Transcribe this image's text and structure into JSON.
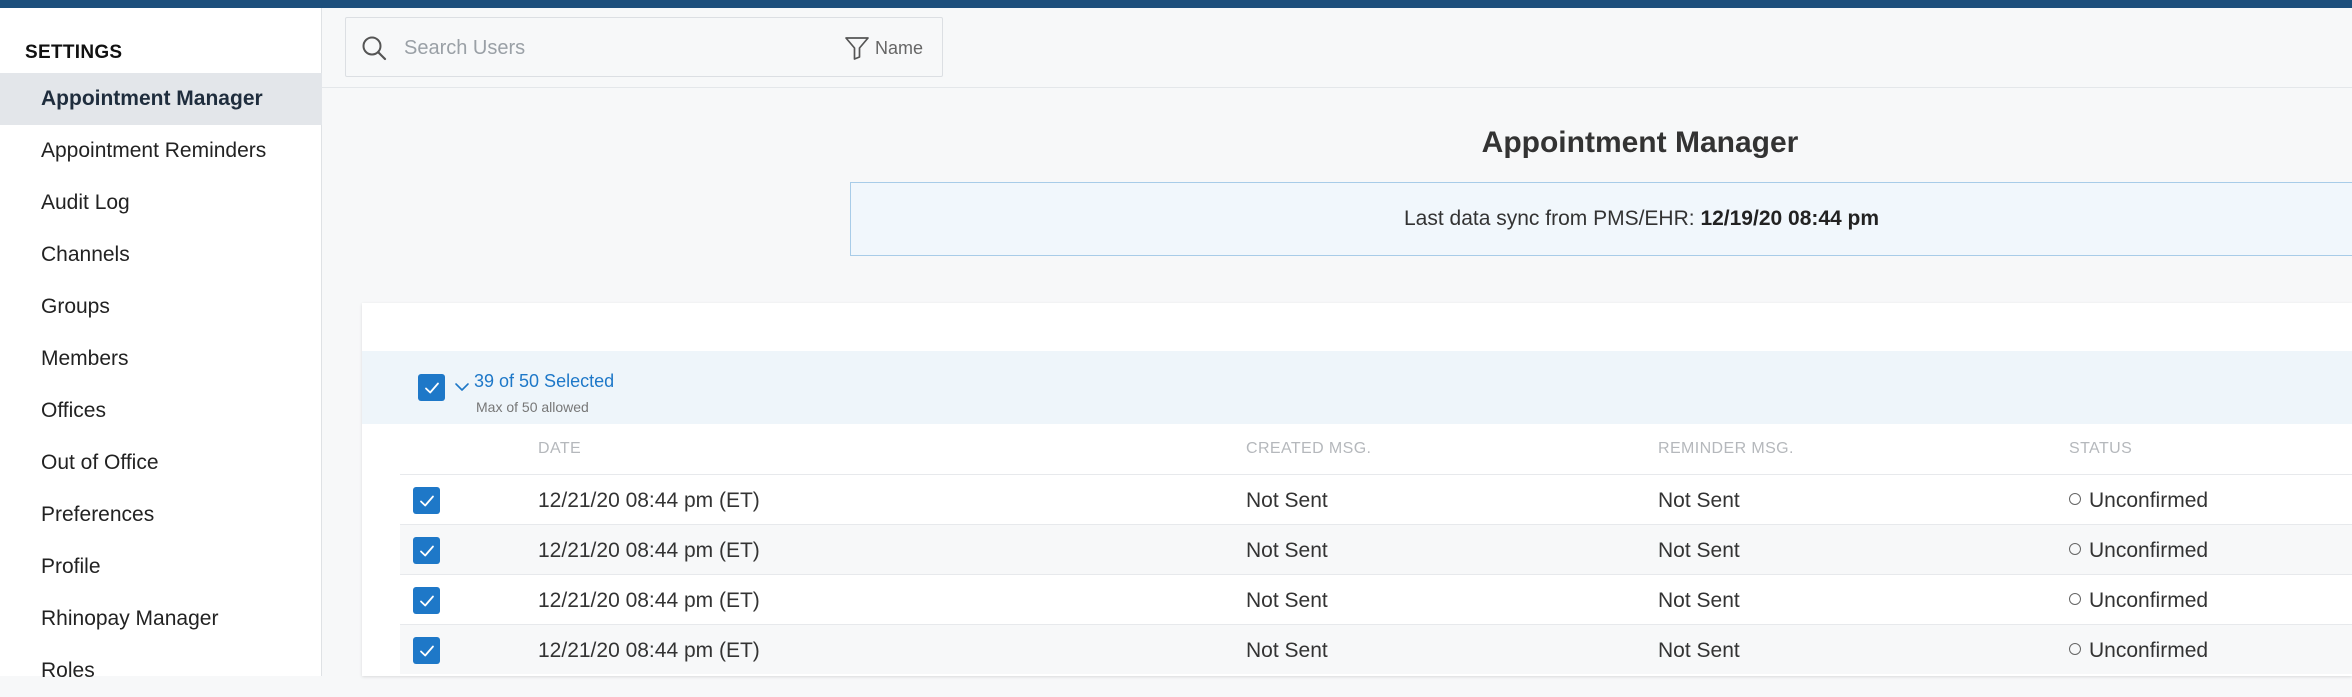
{
  "sidebar": {
    "heading": "SETTINGS",
    "items": [
      {
        "label": "Appointment Manager",
        "active": true
      },
      {
        "label": "Appointment Reminders"
      },
      {
        "label": "Audit Log"
      },
      {
        "label": "Channels"
      },
      {
        "label": "Groups"
      },
      {
        "label": "Members"
      },
      {
        "label": "Offices"
      },
      {
        "label": "Out of Office"
      },
      {
        "label": "Preferences"
      },
      {
        "label": "Profile"
      },
      {
        "label": "Rhinopay Manager"
      },
      {
        "label": "Roles"
      }
    ]
  },
  "search": {
    "placeholder": "Search Users",
    "value": "",
    "filter_label": "Name",
    "icon": "search-icon",
    "filter_icon": "filter-icon"
  },
  "main": {
    "title": "Appointment Manager",
    "sync": {
      "prefix": "Last data sync from PMS/EHR: ",
      "timestamp": "12/19/20 08:44 pm"
    },
    "selection": {
      "count_label": "39 of 50 Selected",
      "max_label": "Max of 50 allowed"
    },
    "table": {
      "columns": [
        "DATE",
        "CREATED MSG.",
        "REMINDER MSG.",
        "STATUS"
      ],
      "rows": [
        {
          "date": "12/21/20 08:44 pm (ET)",
          "created": "Not Sent",
          "reminder": "Not Sent",
          "status": "Unconfirmed",
          "checked": true
        },
        {
          "date": "12/21/20 08:44 pm (ET)",
          "created": "Not Sent",
          "reminder": "Not Sent",
          "status": "Unconfirmed",
          "checked": true
        },
        {
          "date": "12/21/20 08:44 pm (ET)",
          "created": "Not Sent",
          "reminder": "Not Sent",
          "status": "Unconfirmed",
          "checked": true
        },
        {
          "date": "12/21/20 08:44 pm (ET)",
          "created": "Not Sent",
          "reminder": "Not Sent",
          "status": "Unconfirmed",
          "checked": true
        }
      ]
    }
  },
  "colors": {
    "accent": "#1e78c8",
    "topbar": "#1d4f7c",
    "sidebar_active_bg": "#e3e6ea",
    "sync_banner_bg": "#f1f7fc",
    "sync_banner_border": "#a8cce8",
    "select_bar_bg": "#eef5fa"
  }
}
